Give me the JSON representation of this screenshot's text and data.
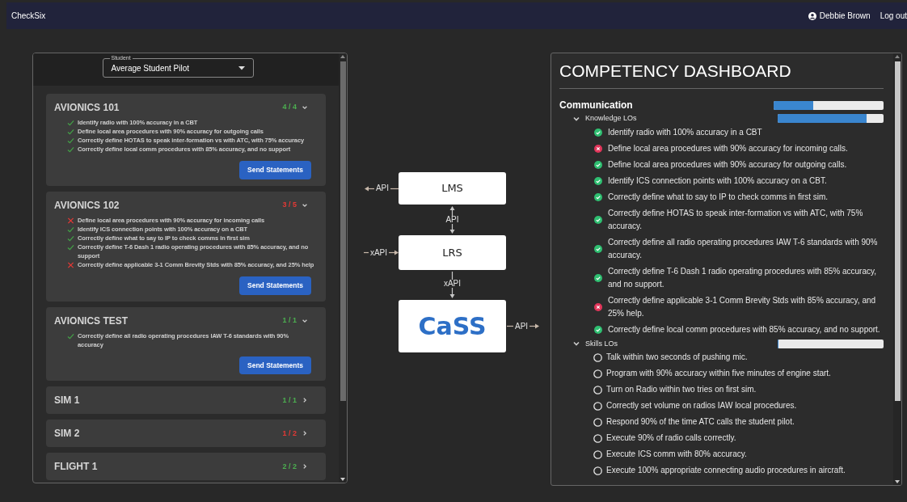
{
  "navbar": {
    "brand": "CheckSix",
    "user": "Debbie Brown",
    "logout": "Log out"
  },
  "student_select": {
    "label": "Student",
    "value": "Average Student Pilot"
  },
  "courses": [
    {
      "title": "AVIONICS 101",
      "count": "4 / 4",
      "passed": true,
      "expanded": true,
      "button": "Send Statements",
      "outcomes": [
        {
          "text": "Identify radio with 100% accuracy in a CBT",
          "met": true
        },
        {
          "text": "Define local area procedures with 90% accuracy for outgoing calls",
          "met": true
        },
        {
          "text": "Correctly define HOTAS to speak inter-formation vs with ATC, with 75% accuracy",
          "met": true
        },
        {
          "text": "Correctly define local comm procedures with 85% accuracy, and no support",
          "met": true
        }
      ]
    },
    {
      "title": "AVIONICS 102",
      "count": "3 / 5",
      "passed": false,
      "expanded": true,
      "button": "Send Statements",
      "outcomes": [
        {
          "text": "Define local area procedures with 90% accuracy for incoming calls",
          "met": false
        },
        {
          "text": "Identify ICS connection points with 100% accuracy on a CBT",
          "met": true
        },
        {
          "text": "Correctly define what to say to IP to check comms in first sim",
          "met": true
        },
        {
          "text": "Correctly define T-6 Dash 1 radio operating procedures with 85% accuracy, and no support",
          "met": true
        },
        {
          "text": "Correctly define applicable 3-1 Comm Brevity Stds with 85% accuracy, and 25% help",
          "met": false
        }
      ]
    },
    {
      "title": "AVIONICS TEST",
      "count": "1 / 1",
      "passed": true,
      "expanded": true,
      "button": "Send Statements",
      "outcomes": [
        {
          "text": "Correctly define all radio operating procedures IAW T-6 standards with 90% accuracy",
          "met": true
        }
      ]
    },
    {
      "title": "SIM 1",
      "count": "1 / 1",
      "passed": true,
      "expanded": false
    },
    {
      "title": "SIM 2",
      "count": "1 / 2",
      "passed": false,
      "expanded": false
    },
    {
      "title": "FLIGHT 1",
      "count": "2 / 2",
      "passed": true,
      "expanded": false
    }
  ],
  "diagram": {
    "nodes": [
      {
        "label": "LMS",
        "kind": "plain"
      },
      {
        "label": "LRS",
        "kind": "plain"
      },
      {
        "label": "CaSS",
        "kind": "brand"
      }
    ],
    "lms_out": "API",
    "lms_lrs": "API",
    "lrs_in": "xAPI",
    "lrs_cass": "xAPI",
    "cass_out": "API"
  },
  "dashboard": {
    "title": "COMPETENCY DASHBOARD",
    "competency": {
      "name": "Communication",
      "level": 0.36
    },
    "groups": [
      {
        "name": "Knowledge LOs",
        "expanded": true,
        "level": 0.84,
        "items": [
          {
            "text": "Identify radio with 100% accuracy in a CBT",
            "kind": "met"
          },
          {
            "text": "Define local area procedures with 90% accuracy for incoming calls.",
            "kind": "failed"
          },
          {
            "text": "Define local area procedures with 90% accuracy for outgoing calls.",
            "kind": "met"
          },
          {
            "text": "Identify ICS connection points with 100% accuracy on a CBT.",
            "kind": "met"
          },
          {
            "text": "Correctly define what to say to IP to check comms in first sim.",
            "kind": "met"
          },
          {
            "text": "Correctly define HOTAS to speak inter-formation vs with ATC, with 75% accuracy.",
            "kind": "met"
          },
          {
            "text": "Correctly define all radio operating procedures IAW T-6 standards with 90% accuracy.",
            "kind": "met"
          },
          {
            "text": "Correctly define T-6 Dash 1 radio operating procedures with 85% accuracy, and no support.",
            "kind": "met"
          },
          {
            "text": "Correctly define applicable 3-1 Comm Brevity Stds with 85% accuracy, and 25% help.",
            "kind": "failed"
          },
          {
            "text": "Correctly define local comm procedures with 85% accuracy, and no support.",
            "kind": "met"
          }
        ]
      },
      {
        "name": "Skills LOs",
        "expanded": true,
        "level": 0,
        "items": [
          {
            "text": "Talk within two seconds of pushing mic.",
            "kind": "open"
          },
          {
            "text": "Program with 90% accuracy within five minutes of engine start.",
            "kind": "open"
          },
          {
            "text": "Turn on Radio within two tries on first sim.",
            "kind": "open"
          },
          {
            "text": "Correctly set volume on radios IAW local procedures.",
            "kind": "open"
          },
          {
            "text": "Respond 90% of the time ATC calls the student pilot.",
            "kind": "open"
          },
          {
            "text": "Execute 90% of radio calls correctly.",
            "kind": "open"
          },
          {
            "text": "Execute ICS comm with 80% accuracy.",
            "kind": "open"
          },
          {
            "text": "Execute 100% appropriate connecting audio procedures in aircraft.",
            "kind": "open"
          }
        ]
      }
    ]
  }
}
